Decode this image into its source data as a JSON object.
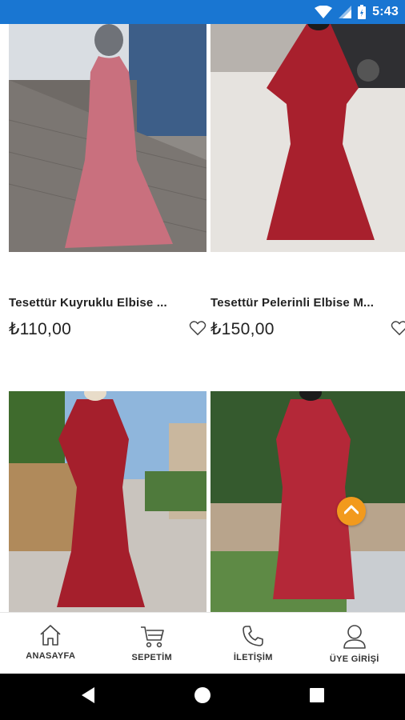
{
  "status_bar": {
    "time": "5:43"
  },
  "products": [
    {
      "title": "Tesettür Kuyruklu Elbise ...",
      "price": "₺110,00",
      "color": "#c9707e"
    },
    {
      "title": "Tesettür Pelerinli Elbise M...",
      "price": "₺150,00",
      "color": "#a8202d"
    },
    {
      "title": "",
      "price": "",
      "color": "#a51f2c"
    },
    {
      "title": "",
      "price": "",
      "color": "#b42838"
    }
  ],
  "bottom_nav": {
    "items": [
      {
        "label": "ANASAYFA",
        "icon": "home-icon"
      },
      {
        "label": "SEPETİM",
        "icon": "cart-icon"
      },
      {
        "label": "İLETİŞİM",
        "icon": "phone-icon"
      },
      {
        "label": "ÜYE GİRİŞİ",
        "icon": "user-icon"
      }
    ]
  },
  "theme": {
    "status_bar": "#1976d2",
    "fab": "#f29a1d"
  }
}
